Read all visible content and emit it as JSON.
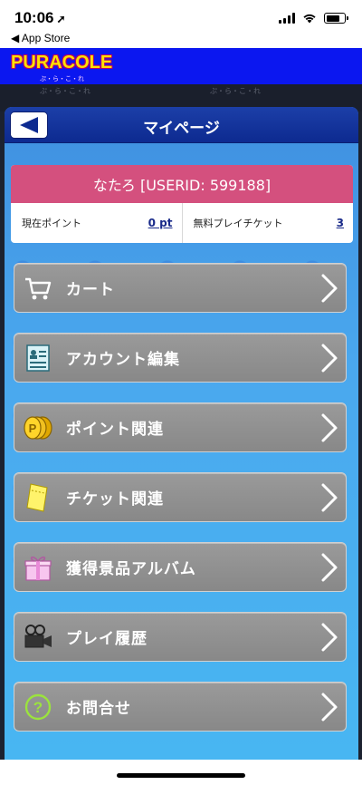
{
  "status_bar": {
    "time": "10:06",
    "location_glyph": "➚",
    "back_app": "◀ App Store"
  },
  "app": {
    "logo": "PURACOLE",
    "logo_sub": "ぷ・ら・こ・れ"
  },
  "band": {
    "text": "ぷ・ら・こ・れ"
  },
  "page": {
    "title": "マイページ"
  },
  "user": {
    "name_line": "なたろ [USERID: 599188]",
    "points_label": "現在ポイント",
    "points_value": "0 pt",
    "tickets_label": "無料プレイチケット",
    "tickets_value": "3"
  },
  "menu": [
    {
      "label": "カート",
      "icon": "cart-icon"
    },
    {
      "label": "アカウント編集",
      "icon": "account-card-icon"
    },
    {
      "label": "ポイント関連",
      "icon": "coins-icon"
    },
    {
      "label": "チケット関連",
      "icon": "ticket-icon"
    },
    {
      "label": "獲得景品アルバム",
      "icon": "gift-icon"
    },
    {
      "label": "プレイ履歴",
      "icon": "video-camera-icon"
    },
    {
      "label": "お問合せ",
      "icon": "question-icon"
    }
  ],
  "colors": {
    "header_blue": "#0b17f0",
    "panel_header": "#0d2a90",
    "name_bar": "#d4507e",
    "menu_gray": "#8f8f8f"
  }
}
